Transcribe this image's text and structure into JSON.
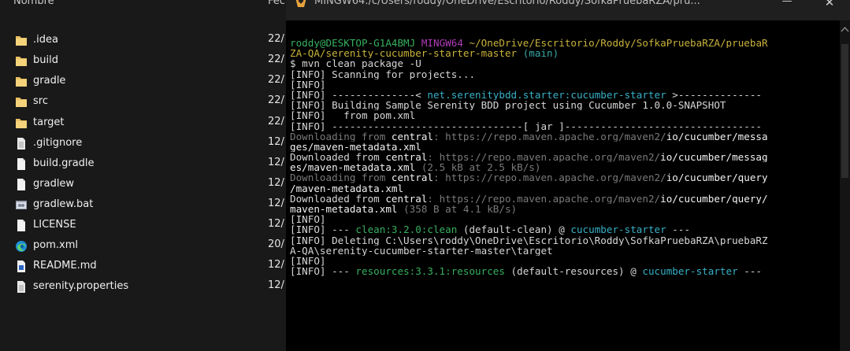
{
  "explorer": {
    "header": {
      "name": "Nombre",
      "date": "Fec"
    },
    "files": [
      {
        "name": ".idea",
        "date": "22/",
        "icon": "folder-icon"
      },
      {
        "name": "build",
        "date": "22/",
        "icon": "folder-icon"
      },
      {
        "name": "gradle",
        "date": "22/",
        "icon": "folder-icon"
      },
      {
        "name": "src",
        "date": "22/",
        "icon": "folder-icon"
      },
      {
        "name": "target",
        "date": "22/",
        "icon": "folder-icon"
      },
      {
        "name": ".gitignore",
        "date": "12/",
        "icon": "file-icon"
      },
      {
        "name": "build.gradle",
        "date": "12/",
        "icon": "gradle-file-icon"
      },
      {
        "name": "gradlew",
        "date": "12/",
        "icon": "file-icon"
      },
      {
        "name": "gradlew.bat",
        "date": "12/",
        "icon": "batch-file-icon"
      },
      {
        "name": "LICENSE",
        "date": "12/",
        "icon": "file-icon"
      },
      {
        "name": "pom.xml",
        "date": "20/",
        "icon": "edge-browser-icon"
      },
      {
        "name": "README.md",
        "date": "12/",
        "icon": "markdown-file-icon"
      },
      {
        "name": "serenity.properties",
        "date": "12/",
        "icon": "file-icon"
      }
    ]
  },
  "terminal": {
    "title": "MINGW64:/c/Users/roddy/OneDrive/Escritorio/Roddy/SofkaPruebaRZA/pru...",
    "minimize": "—",
    "close": "✕",
    "prompt": {
      "user": "roddy@DESKTOP-G1A4BMJ",
      "env": "MINGW64",
      "path": "~/OneDrive/Escritorio/Roddy/SofkaPruebaRZA/pruebaRZA-QA/serenity-cucumber-starter-master",
      "path_line1": "~/OneDrive/Escritorio/Roddy/SofkaPruebaRZA/pruebaR",
      "path_line2": "ZA-QA/serenity-cucumber-starter-master",
      "branch": "(main)"
    },
    "lines": [
      "$ mvn clean package -U",
      "[INFO] Scanning for projects...",
      "[INFO]",
      "[INFO] --------------< ",
      "net.serenitybdd.starter:cucumber-starter",
      " >--------------",
      "[INFO] Building Sample Serenity BDD project using Cucumber 1.0.0-SNAPSHOT",
      "[INFO]   from pom.xml",
      "[INFO] --------------------------------[ jar ]---------------------------------",
      "Downloading from ",
      "central",
      ": https://repo.maven.apache.org/maven2/",
      "io/cucumber/messa",
      "ges/maven-metadata.xml",
      "Downloaded from ",
      ": https://repo.maven.apache.org/maven2/",
      "io/cucumber/messag",
      "es/maven-metadata.xml",
      " (2.5 kB at 2.5 kB/s)",
      "Downloading from ",
      ": https://repo.maven.apache.org/maven2/",
      "io/cucumber/query",
      "/maven-metadata.xml",
      "Downloaded from ",
      ": https://repo.maven.apache.org/maven2/",
      "io/cucumber/query/",
      "maven-metadata.xml",
      " (358 B at 4.1 kB/s)",
      "[INFO]",
      "[INFO] --- ",
      "clean:3.2.0:clean",
      " (default-clean) @ ",
      "cucumber-starter",
      " ---",
      "[INFO] Deleting C:\\Users\\roddy\\OneDrive\\Escritorio\\Roddy\\SofkaPruebaRZA\\pruebaRZ",
      "A-QA\\serenity-cucumber-starter-master\\target",
      "[INFO]",
      "[INFO] --- ",
      "resources:3.3.1:resources",
      " (default-resources) @ ",
      "cucumber-starter",
      " ---"
    ]
  },
  "colors": {
    "user": "#36b05f",
    "env": "#b03db8",
    "path": "#c9b23a",
    "branch": "#3aa6a6",
    "plugin": "#36b05f",
    "artifact": "#37b0c6"
  }
}
